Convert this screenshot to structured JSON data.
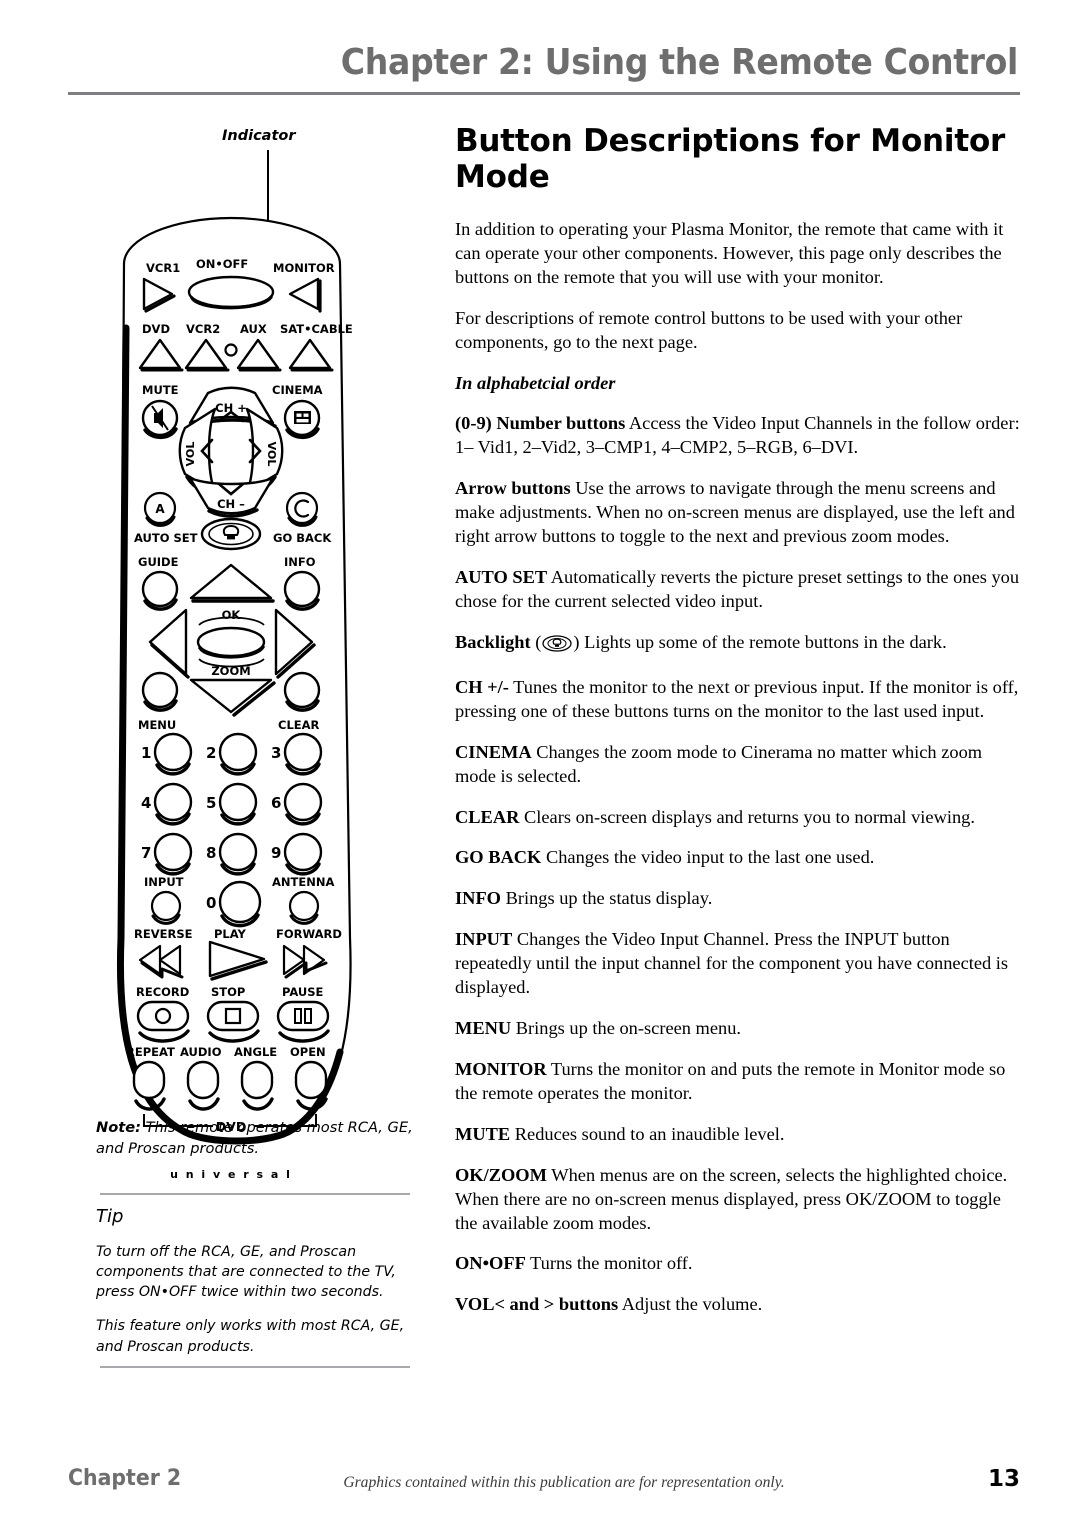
{
  "header": {
    "title": "Chapter 2: Using the Remote Control",
    "rule_color": "#7d7d82",
    "title_color": "#6e6e6e"
  },
  "figure": {
    "indicator_label": "Indicator",
    "brand_text": "u n i v e r s a l",
    "dvd_bracket_label": "DVD",
    "buttons": {
      "vcr1": "VCR1",
      "on_off": "ON•OFF",
      "monitor": "MONITOR",
      "dvd": "DVD",
      "vcr2": "VCR2",
      "aux": "AUX",
      "sat_cable": "SAT•CABLE",
      "mute": "MUTE",
      "cinema": "CINEMA",
      "ch_up": "CH +",
      "ch_down": "CH –",
      "vol_left": "VOL",
      "vol_right": "VOL",
      "auto_set": "AUTO SET",
      "auto_set_glyph": "A",
      "go_back": "GO BACK",
      "guide": "GUIDE",
      "info": "INFO",
      "ok": "OK",
      "zoom": "ZOOM",
      "menu": "MENU",
      "clear": "CLEAR",
      "input": "INPUT",
      "antenna": "ANTENNA",
      "reverse": "REVERSE",
      "play": "PLAY",
      "forward": "FORWARD",
      "record": "RECORD",
      "stop": "STOP",
      "pause": "PAUSE",
      "repeat": "REPEAT",
      "audio": "AUDIO",
      "angle": "ANGLE",
      "open": "OPEN"
    },
    "number_keys": [
      "1",
      "2",
      "3",
      "4",
      "5",
      "6",
      "7",
      "8",
      "9",
      "0"
    ]
  },
  "sidebar": {
    "note_label": "Note:",
    "note_text": " This remote operates most RCA, GE, and Proscan products.",
    "tip_heading": "Tip",
    "tip_paragraphs": [
      "To turn off the RCA, GE, and Proscan components that are connected to the TV, press ON•OFF twice within two seconds.",
      "This feature only works with most RCA, GE, and Proscan products."
    ]
  },
  "main": {
    "title": "Button Descriptions for Monitor Mode",
    "intro_1": "In addition to operating your Plasma Monitor, the remote that came with it can operate your other components. However, this page only describes the buttons on the remote that you will use with your monitor.",
    "intro_2": "For descriptions of remote control buttons to be used with your other components, go to the next page.",
    "alpha_note": "In alphabetcial order",
    "entries": [
      {
        "term": "(0-9) Number buttons",
        "desc": " Access the Video Input Channels in the follow order: 1– Vid1, 2–Vid2, 3–CMP1, 4–CMP2, 5–RGB, 6–DVI."
      },
      {
        "term": "Arrow buttons",
        "desc": " Use the arrows to navigate through the menu screens and make adjustments. When no on-screen menus are displayed, use the left and right arrow buttons to toggle to the next and previous zoom modes."
      },
      {
        "term": "AUTO SET",
        "desc": " Automatically reverts the picture preset settings to the ones you chose for the current selected video input."
      },
      {
        "term": "Backlight",
        "desc": ") Lights up some of the remote buttons in the dark.",
        "pre_icon": " ("
      },
      {
        "term": "CH +/-",
        "desc": "  Tunes the monitor to the next or previous input. If the monitor is off, pressing one of these buttons turns on the monitor to the last used input."
      },
      {
        "term": "CINEMA",
        "desc": " Changes the zoom mode to Cinerama no matter which zoom mode is selected."
      },
      {
        "term": "CLEAR",
        "desc": " Clears on-screen displays and returns you to normal viewing."
      },
      {
        "term": "GO BACK",
        "desc": "  Changes the video input to the last one used."
      },
      {
        "term": "INFO",
        "desc": " Brings up the status display."
      },
      {
        "term": "INPUT",
        "desc": " Changes the Video Input Channel. Press the INPUT button repeatedly until the input channel for the component you have connected is displayed."
      },
      {
        "term": "MENU",
        "desc": " Brings up the on-screen menu."
      },
      {
        "term": "MONITOR",
        "desc": " Turns the monitor on and puts the remote in Monitor mode so the remote operates the monitor."
      },
      {
        "term": "MUTE",
        "desc": " Reduces sound to an inaudible level."
      },
      {
        "term": "OK/ZOOM",
        "desc": "  When menus are on the screen, selects the highlighted choice. When there are no on-screen menus displayed, press OK/ZOOM to toggle the available zoom modes."
      },
      {
        "term": "ON•OFF",
        "desc": "  Turns the monitor off."
      },
      {
        "term": "VOL< and > buttons",
        "desc": " Adjust the volume."
      }
    ]
  },
  "footer": {
    "chapter": "Chapter 2",
    "caption": "Graphics contained within this publication are for representation only.",
    "page": "13"
  }
}
